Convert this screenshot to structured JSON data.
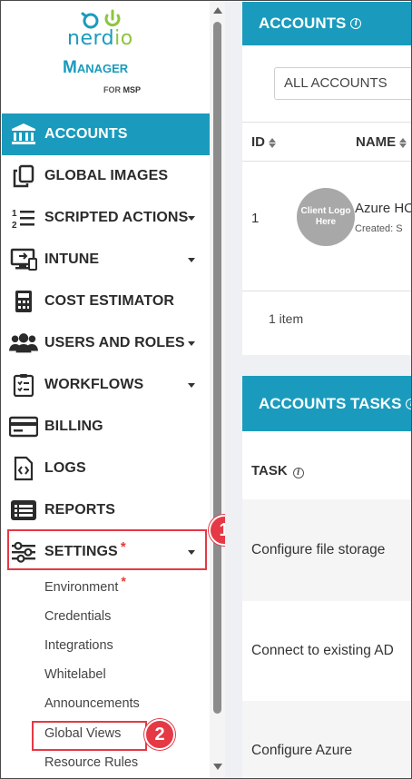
{
  "brand": {
    "wordmark_main": "nerd",
    "wordmark_accent": "io",
    "product": "Manager",
    "edition_prefix": "FOR",
    "edition": "MSP",
    "primary_color": "#1a9bbd",
    "accent_color": "#8cc63f"
  },
  "sidebar": {
    "items": [
      {
        "label": "ACCOUNTS",
        "icon": "bank-icon",
        "active": true
      },
      {
        "label": "GLOBAL IMAGES",
        "icon": "copy-icon"
      },
      {
        "label": "SCRIPTED ACTIONS",
        "icon": "numbered-list-icon",
        "expandable": true
      },
      {
        "label": "INTUNE",
        "icon": "desktop-sync-icon",
        "expandable": true
      },
      {
        "label": "COST ESTIMATOR",
        "icon": "calculator-icon"
      },
      {
        "label": "USERS AND ROLES",
        "icon": "users-icon",
        "expandable": true
      },
      {
        "label": "WORKFLOWS",
        "icon": "clipboard-icon",
        "expandable": true
      },
      {
        "label": "BILLING",
        "icon": "credit-card-icon"
      },
      {
        "label": "LOGS",
        "icon": "code-file-icon"
      },
      {
        "label": "REPORTS",
        "icon": "report-list-icon"
      },
      {
        "label": "SETTINGS",
        "icon": "sliders-icon",
        "expandable": true,
        "required": "*"
      }
    ],
    "settings_subitems": [
      {
        "label": "Environment",
        "required": "*"
      },
      {
        "label": "Credentials"
      },
      {
        "label": "Integrations"
      },
      {
        "label": "Whitelabel"
      },
      {
        "label": "Announcements"
      },
      {
        "label": "Global Views"
      },
      {
        "label": "Resource Rules"
      }
    ]
  },
  "callouts": {
    "step1": "1",
    "step2": "2",
    "highlight_color": "#e53945"
  },
  "accounts_card": {
    "title": "ACCOUNTS",
    "filter_value": "ALL ACCOUNTS",
    "columns": [
      "ID",
      "NAME"
    ],
    "rows": [
      {
        "id": "1",
        "logo_text": "Client Logo Here",
        "name": "Azure HC",
        "created": "Created: S"
      }
    ],
    "footer": "1 item"
  },
  "tasks_card": {
    "title": "ACCOUNTS TASKS",
    "column": "TASK",
    "rows": [
      "Configure file storage",
      "Connect to existing AD",
      "Configure Azure"
    ]
  }
}
